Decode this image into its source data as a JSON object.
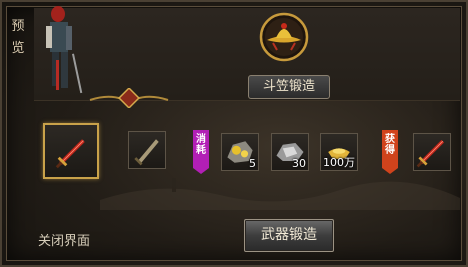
{
  "preview": {
    "label": "预览"
  },
  "recipe": {
    "title": "斗笠锻造"
  },
  "slots": {
    "equipped_weapon": {
      "icon": "red-sword-icon"
    },
    "target_weapon": {
      "icon": "bronze-blade-icon"
    },
    "consume_tag": "消耗",
    "materials": [
      {
        "icon": "gold-ore-icon",
        "qty": "5"
      },
      {
        "icon": "silver-ore-icon",
        "qty": "30"
      },
      {
        "icon": "gold-ingot-icon",
        "qty": "100万"
      }
    ],
    "obtain_tag": "获得",
    "result": {
      "icon": "red-sword-icon"
    }
  },
  "footer": {
    "close_label": "关闭界面",
    "forge_button": "武器锻造"
  },
  "colors": {
    "consume_tag": "#b21fb5",
    "obtain_tag": "#d0431c",
    "gold_border": "#c9a24a"
  }
}
